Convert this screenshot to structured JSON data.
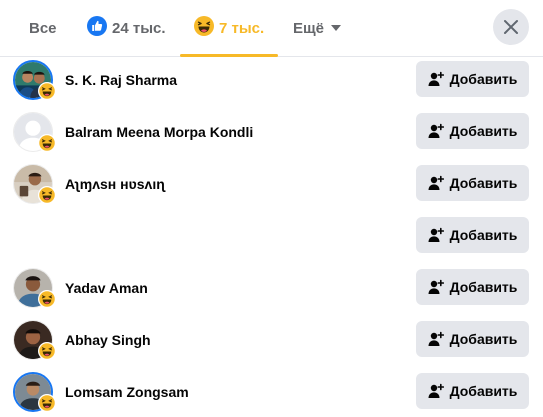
{
  "tabs": {
    "all_label": "Все",
    "like_count": "24 тыс.",
    "haha_count": "7 тыс.",
    "more_label": "Ещё"
  },
  "add_button_label": "Добавить",
  "people": [
    {
      "name": "S. K. Raj Sharma",
      "reaction": "haha",
      "avatar": "photo",
      "story_ring": true
    },
    {
      "name": "Balram Meena Morpa Kondli",
      "reaction": "haha",
      "avatar": "default-silhouette",
      "story_ring": false
    },
    {
      "name": "Aʅɱʌsʜ ʜʋsʌıɳ",
      "reaction": "haha",
      "avatar": "photo",
      "story_ring": false
    },
    {
      "name": "",
      "reaction": "",
      "avatar": "",
      "story_ring": false
    },
    {
      "name": "Yadav Aman",
      "reaction": "haha",
      "avatar": "photo",
      "story_ring": false
    },
    {
      "name": "Abhay Singh",
      "reaction": "haha",
      "avatar": "photo",
      "story_ring": false
    },
    {
      "name": "Lomsam Zongsam",
      "reaction": "haha",
      "avatar": "photo",
      "story_ring": true
    }
  ],
  "colors": {
    "like_blue": "#1877f2",
    "haha_yellow": "#f7b928",
    "button_gray": "#e4e6eb",
    "secondary_text": "#65676b"
  }
}
